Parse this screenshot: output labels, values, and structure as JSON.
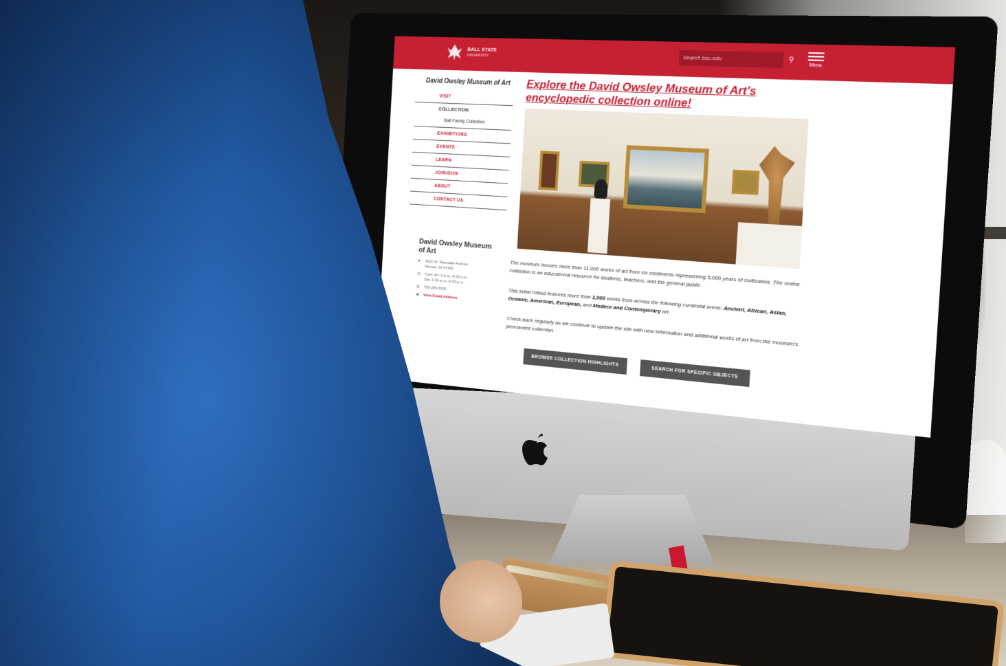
{
  "header": {
    "logo_line1": "BALL STATE",
    "logo_line2": "UNIVERSITY",
    "search_placeholder": "Search bsu.edu",
    "menu_label": "Menu"
  },
  "sidebar": {
    "title": "David Owsley Museum of Art",
    "items": [
      {
        "label": "VISIT"
      },
      {
        "label": "COLLECTION"
      },
      {
        "label": "Ball Family Collection"
      },
      {
        "label": "EXHIBITIONS"
      },
      {
        "label": "EVENTS"
      },
      {
        "label": "LEARN"
      },
      {
        "label": "JOIN/GIVE"
      },
      {
        "label": "ABOUT"
      },
      {
        "label": "CONTACT US"
      }
    ]
  },
  "contact": {
    "title": "David Owsley Museum of Art",
    "address_line1": "2021 W. Riverside Avenue",
    "address_line2": "Muncie, IN 47306",
    "hours_line1": "Tues–Fri: 9 a.m.–4:30 p.m.",
    "hours_line2": "Sat: 1:30 p.m.–4:30 p.m.",
    "phone": "765-285-5242",
    "email": "View Email Address"
  },
  "main": {
    "headline": "Explore the David Owsley Museum of Art's encyclopedic collection online!",
    "para1": "The museum houses more than 11,000 works of art from six continents representing 5,000 years of civilization. The online collection is an educational resource for students, teachers, and the general public.",
    "para2_start": "This initial rollout features more than ",
    "para2_count": "1,000",
    "para2_mid": " works from across the following curatorial areas: ",
    "para2_areas_a": "Ancient, African, Asian, Oceanic, American, European,",
    "para2_and": " and ",
    "para2_areas_b": "Modern and Contemporary",
    "para2_end": " art.",
    "para3": "Check back regularly as we continue to update the site with new information and additional works of art from the museum's permanent collection.",
    "button_browse": "BROWSE COLLECTION HIGHLIGHTS",
    "button_search": "SEARCH FOR SPECIFIC OBJECTS"
  },
  "colors": {
    "brand_red": "#c62033",
    "button_gray": "#555555"
  }
}
